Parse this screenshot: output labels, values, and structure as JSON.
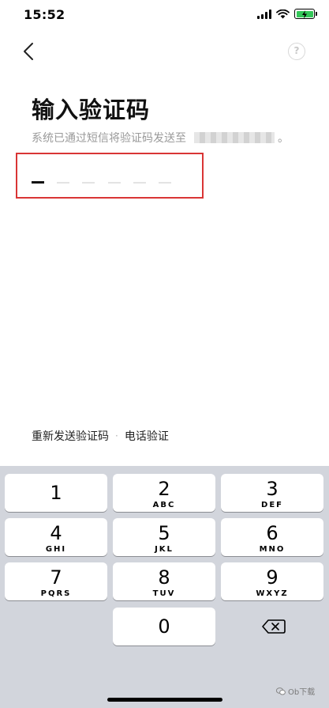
{
  "status_bar": {
    "time": "15:52"
  },
  "header": {
    "help_label": "?"
  },
  "title": "输入验证码",
  "subtitle": {
    "prefix": "系统已通过短信将验证码发送至",
    "suffix": "。"
  },
  "code_input": {
    "length": 6,
    "filled": 0
  },
  "links": {
    "resend": "重新发送验证码",
    "separator": "·",
    "phone_verify": "电话验证"
  },
  "keyboard": {
    "keys": [
      {
        "num": "1",
        "letters": ""
      },
      {
        "num": "2",
        "letters": "ABC"
      },
      {
        "num": "3",
        "letters": "DEF"
      },
      {
        "num": "4",
        "letters": "GHI"
      },
      {
        "num": "5",
        "letters": "JKL"
      },
      {
        "num": "6",
        "letters": "MNO"
      },
      {
        "num": "7",
        "letters": "PQRS"
      },
      {
        "num": "8",
        "letters": "TUV"
      },
      {
        "num": "9",
        "letters": "WXYZ"
      },
      {
        "num": "0",
        "letters": ""
      }
    ]
  },
  "watermark": {
    "text": "Ob下载"
  },
  "colors": {
    "highlight_border": "#d93535",
    "keyboard_background": "#d2d5dc",
    "battery": "#34c759"
  }
}
